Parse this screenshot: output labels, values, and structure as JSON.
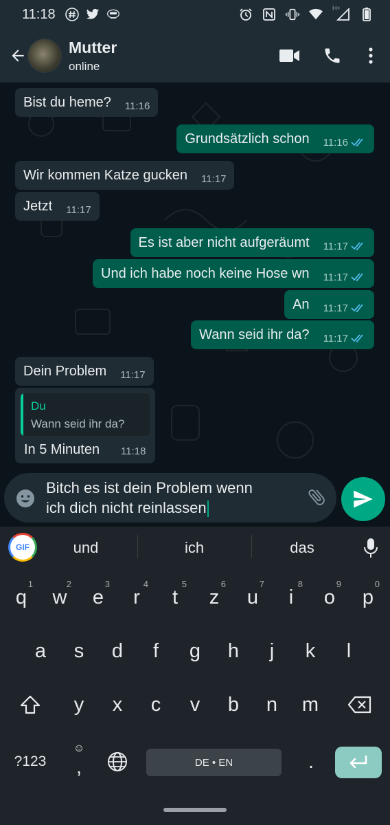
{
  "status_bar": {
    "time": "11:18",
    "network": "H+"
  },
  "header": {
    "contact_name": "Mutter",
    "contact_status": "online"
  },
  "messages": [
    {
      "dir": "in",
      "text": "Bist du heme?",
      "time": "11:16"
    },
    {
      "dir": "out",
      "text": "Grundsätzlich schon",
      "time": "11:16",
      "read": true
    },
    {
      "dir": "in",
      "text": "Wir kommen Katze gucken",
      "time": "11:17"
    },
    {
      "dir": "in",
      "text": "Jetzt",
      "time": "11:17"
    },
    {
      "dir": "out",
      "text": "Es ist aber nicht aufgeräumt",
      "time": "11:17",
      "read": true
    },
    {
      "dir": "out",
      "text": "Und ich habe noch keine Hose wn",
      "time": "11:17",
      "read": true
    },
    {
      "dir": "out",
      "text": "An",
      "time": "11:17",
      "read": true
    },
    {
      "dir": "out",
      "text": "Wann seid ihr da?",
      "time": "11:17",
      "read": true
    },
    {
      "dir": "in",
      "text": "Dein Problem",
      "time": "11:17"
    }
  ],
  "reply_message": {
    "quote_author": "Du",
    "quote_text": "Wann seid ihr da?",
    "text": "In 5 Minuten",
    "time": "11:18"
  },
  "compose": {
    "line1": "Bitch es ist dein Problem wenn",
    "line2": "ich dich nicht reinlassen"
  },
  "suggestions": {
    "gif": "GIF",
    "words": [
      "und",
      "ich",
      "das"
    ]
  },
  "keyboard": {
    "row1": [
      "q",
      "w",
      "e",
      "r",
      "t",
      "z",
      "u",
      "i",
      "o",
      "p"
    ],
    "row1_hints": [
      "1",
      "2",
      "3",
      "4",
      "5",
      "6",
      "7",
      "8",
      "9",
      "0"
    ],
    "row2": [
      "a",
      "s",
      "d",
      "f",
      "g",
      "h",
      "j",
      "k",
      "l"
    ],
    "row3": [
      "y",
      "x",
      "c",
      "v",
      "b",
      "n",
      "m"
    ],
    "symbols_label": "?123",
    "comma": ",",
    "period": ".",
    "space_label": "DE • EN"
  },
  "colors": {
    "accent": "#00a884",
    "outgoing_bubble": "#005c4b",
    "incoming_bubble": "#202c33",
    "read_ticks": "#53bdeb"
  }
}
